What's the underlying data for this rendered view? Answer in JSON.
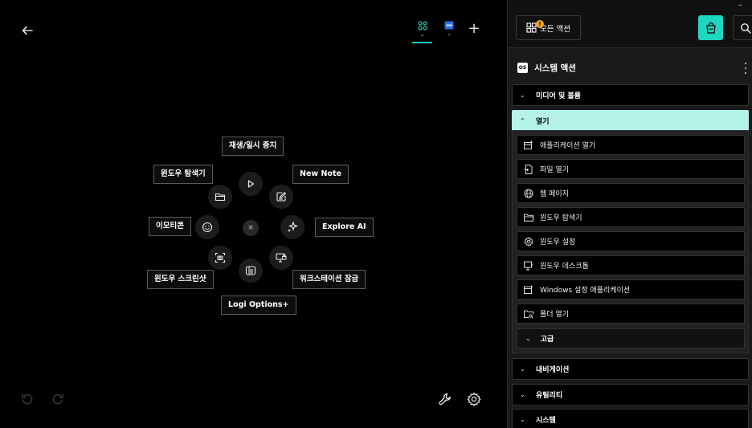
{
  "canvas": {
    "ring": {
      "top": "재생/일시 중지",
      "top_right": "New Note",
      "right": "Explore AI",
      "bottom_right": "워크스테이션 잠금",
      "bottom": "Logi Options+",
      "bottom_left": "윈도우 스크린샷",
      "left": "이모티콘",
      "top_left": "윈도우 탐색기",
      "center": "×"
    },
    "add": "+"
  },
  "panel": {
    "all_actions_label": "모든 액션",
    "badge": "!",
    "minimize": "–",
    "section_title": "시스템 액션",
    "os_badge": "OS",
    "categories": {
      "media": "미디어 및 볼륨",
      "open": "열기",
      "navigation": "내비게이션",
      "utility": "유틸리티",
      "system": "시스템"
    },
    "open_items": [
      "애플리케이션 열기",
      "파일 열기",
      "웹 페이지",
      "윈도우 탐색기",
      "윈도우 설정",
      "윈도우 데스크톱",
      "Windows 설정 애플리케이션",
      "폴더 열기"
    ],
    "advanced": "고급"
  },
  "colors": {
    "accent": "#1fd6c0",
    "open_category_bg": "#b5f3ea",
    "badge": "#f0a020"
  }
}
